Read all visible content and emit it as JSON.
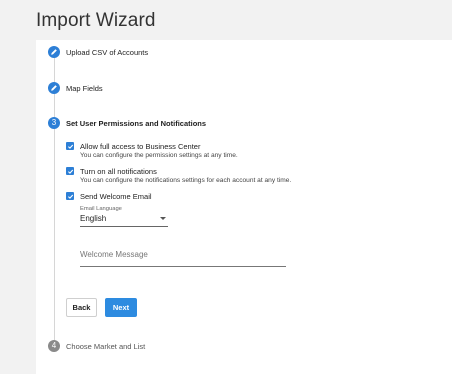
{
  "page_title": "Import Wizard",
  "steps": [
    {
      "number": "",
      "icon": "pencil-icon",
      "label": "Upload CSV of Accounts",
      "status": "done"
    },
    {
      "number": "",
      "icon": "pencil-icon",
      "label": "Map Fields",
      "status": "done"
    },
    {
      "number": "3",
      "icon": "",
      "label": "Set User Permissions and Notifications",
      "status": "active"
    },
    {
      "number": "4",
      "icon": "",
      "label": "Choose Market and List",
      "status": "pending"
    }
  ],
  "options": [
    {
      "title": "Allow full access to Business Center",
      "subtitle": "You can configure the permission settings at any time.",
      "checked": true
    },
    {
      "title": "Turn on all notifications",
      "subtitle": "You can configure the notifications settings for each account at any time.",
      "checked": true
    },
    {
      "title": "Send Welcome Email",
      "subtitle": "",
      "checked": true
    }
  ],
  "email_language": {
    "label": "Email Language",
    "value": "English"
  },
  "welcome_message": {
    "placeholder": "Welcome Message",
    "value": ""
  },
  "buttons": {
    "back": "Back",
    "next": "Next"
  },
  "colors": {
    "accent": "#2d7fd6",
    "pending": "#8a8a8a",
    "background": "#f2f2f2"
  }
}
